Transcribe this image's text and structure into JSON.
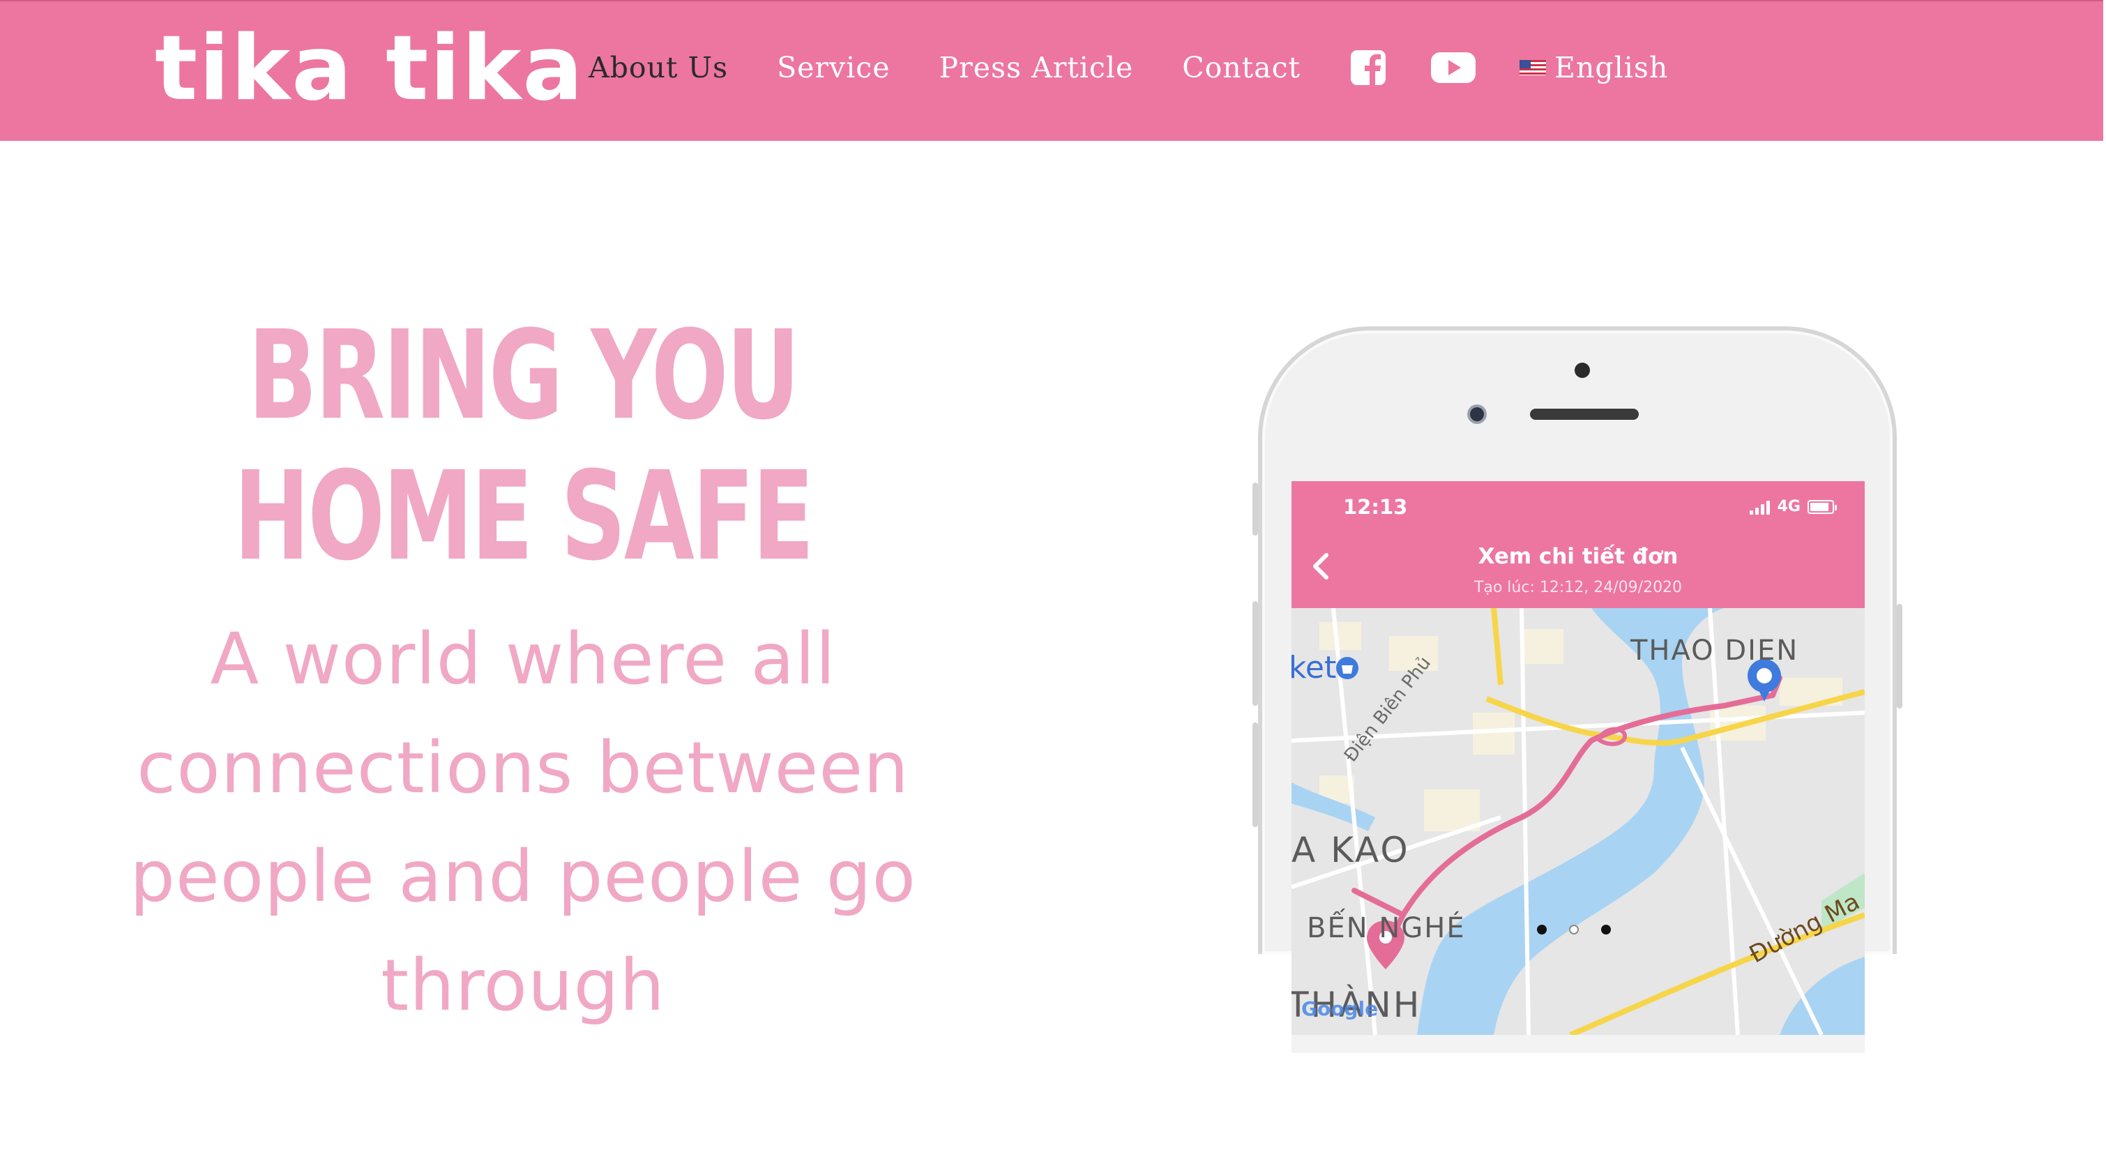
{
  "header": {
    "logo_text": "tika tika",
    "nav": [
      {
        "label": "About Us",
        "active": true
      },
      {
        "label": "Service"
      },
      {
        "label": "Press Article"
      },
      {
        "label": "Contact"
      }
    ],
    "social_icons": [
      "facebook-icon",
      "youtube-icon"
    ],
    "language": {
      "label": "English",
      "flag": "us-flag-icon"
    },
    "colors": {
      "bar": "#ec769f",
      "active_link": "#2a2a2a",
      "link": "#ffffff"
    }
  },
  "hero": {
    "headline": "BRING YOU HOME SAFE",
    "subheadline": "A world where all connections between people and people go through",
    "text_color": "#f0a8c4"
  },
  "phone_screen": {
    "status_time": "12:13",
    "network": "4G",
    "title": "Xem chi tiết đơn",
    "subtitle": "Tạo lúc: 12:12, 24/09/2020",
    "map_labels": {
      "thao_dien": "THAO DIEN",
      "ket": "ket",
      "dien_bien_phu": "Điện Biên Phủ",
      "da_kao": "A KAO",
      "ben_nghe": "BẾN NGHÉ",
      "thanh": "THÀNH",
      "duong_ma": "Đường Ma",
      "google": "Google"
    }
  },
  "carousel": {
    "count": 3,
    "active_index": 1
  }
}
